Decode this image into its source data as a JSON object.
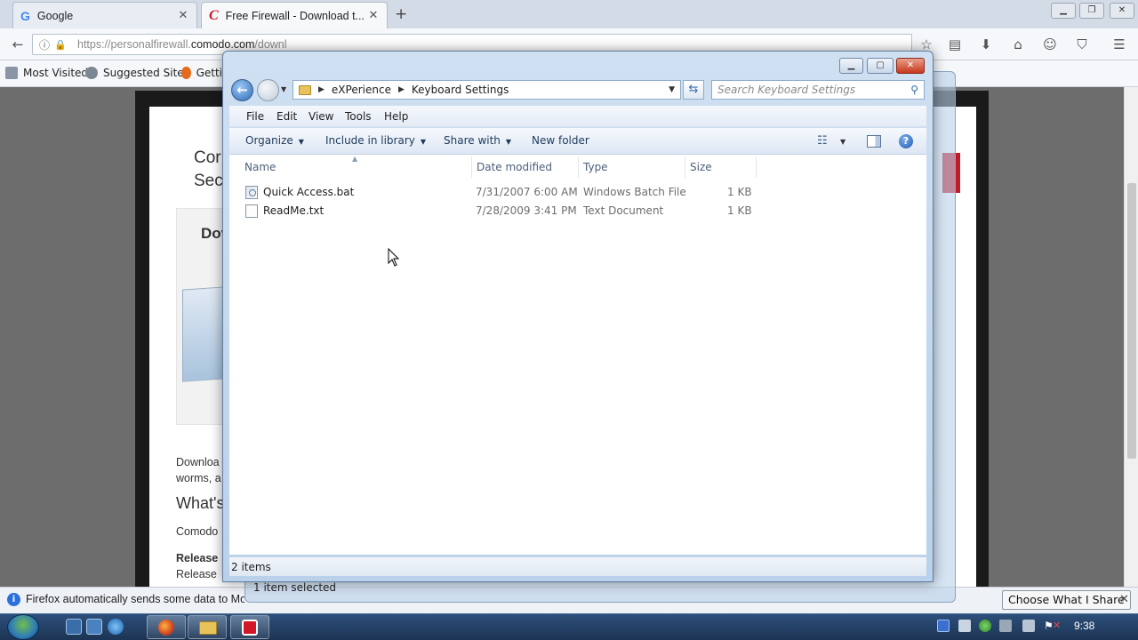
{
  "browser": {
    "tabs": [
      {
        "title": "Google",
        "active": false
      },
      {
        "title": "Free Firewall - Download t...",
        "active": true
      }
    ],
    "url": {
      "prefix": "https://personalfirewall.",
      "domain": "comodo.com",
      "rest": "/downl"
    },
    "bookmarks": [
      "Most Visited",
      "Suggested Sites",
      "Getti"
    ],
    "page": {
      "heading_fragments": [
        "Cor",
        "Sec"
      ],
      "box_title": "Dov",
      "para1": "Downloa",
      "para1b": "worms, a",
      "h2": "What's",
      "para2": "Comodo",
      "release_bold": "Release",
      "release_text": "Release"
    },
    "notification": {
      "text": "Firefox automatically sends some data to Mozil",
      "button": "Choose What I Share"
    }
  },
  "explorer": {
    "breadcrumb": [
      "eXPerience",
      "Keyboard Settings"
    ],
    "search_placeholder": "Search Keyboard Settings",
    "menu": [
      "File",
      "Edit",
      "View",
      "Tools",
      "Help"
    ],
    "commands": [
      "Organize",
      "Include in library",
      "Share with",
      "New folder"
    ],
    "columns": [
      "Name",
      "Date modified",
      "Type",
      "Size"
    ],
    "files": [
      {
        "name": "Quick Access.bat",
        "date": "7/31/2007 6:00 AM",
        "type": "Windows Batch File",
        "size": "1 KB",
        "icon": "batch-file-icon"
      },
      {
        "name": "ReadMe.txt",
        "date": "7/28/2009 3:41 PM",
        "type": "Text Document",
        "size": "1 KB",
        "icon": "text-file-icon"
      }
    ],
    "status_items": "2 items",
    "status_selected": "1 item selected"
  },
  "taskbar": {
    "time": "9:38"
  },
  "colors": {
    "accent": "#2d6ab6",
    "taskbar": "#1c3454",
    "comodo_red": "#d2172a"
  }
}
